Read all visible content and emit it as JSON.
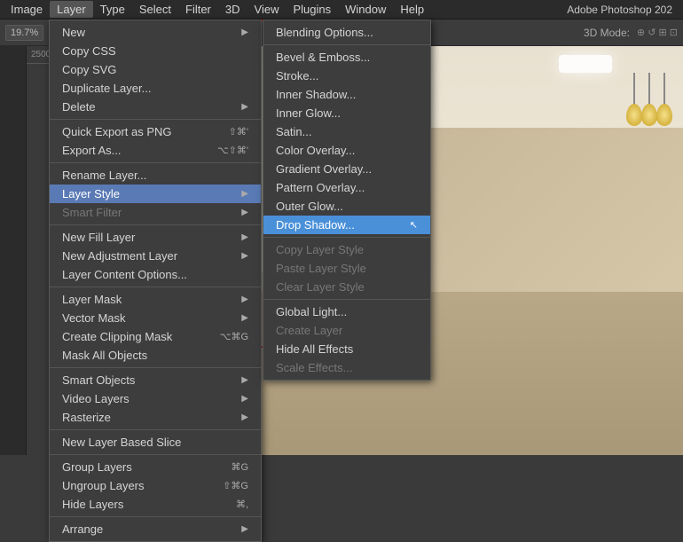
{
  "app": {
    "title": "Adobe Photoshop 202"
  },
  "menubar": {
    "items": [
      {
        "id": "image",
        "label": "Image"
      },
      {
        "id": "layer",
        "label": "Layer"
      },
      {
        "id": "type",
        "label": "Type"
      },
      {
        "id": "select",
        "label": "Select"
      },
      {
        "id": "filter",
        "label": "Filter"
      },
      {
        "id": "3d",
        "label": "3D"
      },
      {
        "id": "view",
        "label": "View"
      },
      {
        "id": "plugins",
        "label": "Plugins"
      },
      {
        "id": "window",
        "label": "Window"
      },
      {
        "id": "help",
        "label": "Help"
      }
    ]
  },
  "toolbar": {
    "zoom_label": "19.7%",
    "mode_label": "3D Mode:"
  },
  "layer_menu": {
    "items": [
      {
        "id": "new",
        "label": "New",
        "arrow": true,
        "shortcut": ""
      },
      {
        "id": "copy-css",
        "label": "Copy CSS",
        "arrow": false,
        "shortcut": ""
      },
      {
        "id": "copy-svg",
        "label": "Copy SVG",
        "arrow": false,
        "shortcut": ""
      },
      {
        "id": "duplicate-layer",
        "label": "Duplicate Layer...",
        "arrow": false,
        "shortcut": ""
      },
      {
        "id": "delete",
        "label": "Delete",
        "arrow": true,
        "shortcut": ""
      },
      {
        "id": "sep1",
        "type": "separator"
      },
      {
        "id": "quick-export",
        "label": "Quick Export as PNG",
        "arrow": false,
        "shortcut": "⇧⌘'"
      },
      {
        "id": "export-as",
        "label": "Export As...",
        "arrow": false,
        "shortcut": "⌥⇧⌘'"
      },
      {
        "id": "sep2",
        "type": "separator"
      },
      {
        "id": "rename-layer",
        "label": "Rename Layer...",
        "arrow": false,
        "shortcut": ""
      },
      {
        "id": "layer-style",
        "label": "Layer Style",
        "arrow": true,
        "shortcut": "",
        "highlighted": true
      },
      {
        "id": "smart-filter",
        "label": "Smart Filter",
        "arrow": false,
        "shortcut": "",
        "disabled": true
      },
      {
        "id": "sep3",
        "type": "separator"
      },
      {
        "id": "new-fill-layer",
        "label": "New Fill Layer",
        "arrow": true,
        "shortcut": ""
      },
      {
        "id": "new-adjustment-layer",
        "label": "New Adjustment Layer",
        "arrow": true,
        "shortcut": ""
      },
      {
        "id": "layer-content-options",
        "label": "Layer Content Options...",
        "arrow": false,
        "shortcut": ""
      },
      {
        "id": "sep4",
        "type": "separator"
      },
      {
        "id": "layer-mask",
        "label": "Layer Mask",
        "arrow": true,
        "shortcut": ""
      },
      {
        "id": "vector-mask",
        "label": "Vector Mask",
        "arrow": true,
        "shortcut": ""
      },
      {
        "id": "create-clipping-mask",
        "label": "Create Clipping Mask",
        "arrow": false,
        "shortcut": "⌥⌘G"
      },
      {
        "id": "mask-all-objects",
        "label": "Mask All Objects",
        "arrow": false,
        "shortcut": ""
      },
      {
        "id": "sep5",
        "type": "separator"
      },
      {
        "id": "smart-objects",
        "label": "Smart Objects",
        "arrow": true,
        "shortcut": ""
      },
      {
        "id": "video-layers",
        "label": "Video Layers",
        "arrow": true,
        "shortcut": ""
      },
      {
        "id": "rasterize",
        "label": "Rasterize",
        "arrow": true,
        "shortcut": ""
      },
      {
        "id": "sep6",
        "type": "separator"
      },
      {
        "id": "new-layer-based-slice",
        "label": "New Layer Based Slice",
        "arrow": false,
        "shortcut": ""
      },
      {
        "id": "sep7",
        "type": "separator"
      },
      {
        "id": "group-layers",
        "label": "Group Layers",
        "arrow": false,
        "shortcut": "⌘G"
      },
      {
        "id": "ungroup-layers",
        "label": "Ungroup Layers",
        "arrow": false,
        "shortcut": "⇧⌘G"
      },
      {
        "id": "hide-layers",
        "label": "Hide Layers",
        "arrow": false,
        "shortcut": "⌘,"
      },
      {
        "id": "sep8",
        "type": "separator"
      },
      {
        "id": "arrange",
        "label": "Arrange",
        "arrow": true,
        "shortcut": ""
      }
    ]
  },
  "layer_style_menu": {
    "items": [
      {
        "id": "blending-options",
        "label": "Blending Options...",
        "disabled": false
      },
      {
        "id": "sep1",
        "type": "separator"
      },
      {
        "id": "bevel-emboss",
        "label": "Bevel & Emboss...",
        "disabled": false
      },
      {
        "id": "stroke",
        "label": "Stroke...",
        "disabled": false
      },
      {
        "id": "inner-shadow",
        "label": "Inner Shadow...",
        "disabled": false
      },
      {
        "id": "inner-glow",
        "label": "Inner Glow...",
        "disabled": false
      },
      {
        "id": "satin",
        "label": "Satin...",
        "disabled": false
      },
      {
        "id": "color-overlay",
        "label": "Color Overlay...",
        "disabled": false
      },
      {
        "id": "gradient-overlay",
        "label": "Gradient Overlay...",
        "disabled": false
      },
      {
        "id": "pattern-overlay",
        "label": "Pattern Overlay...",
        "disabled": false
      },
      {
        "id": "outer-glow",
        "label": "Outer Glow...",
        "disabled": false
      },
      {
        "id": "drop-shadow",
        "label": "Drop Shadow...",
        "disabled": false,
        "active": true
      },
      {
        "id": "sep2",
        "type": "separator"
      },
      {
        "id": "copy-layer-style",
        "label": "Copy Layer Style",
        "disabled": true
      },
      {
        "id": "paste-layer-style",
        "label": "Paste Layer Style",
        "disabled": true
      },
      {
        "id": "clear-layer-style",
        "label": "Clear Layer Style",
        "disabled": true
      },
      {
        "id": "sep3",
        "type": "separator"
      },
      {
        "id": "global-light",
        "label": "Global Light...",
        "disabled": false
      },
      {
        "id": "create-layer",
        "label": "Create Layer",
        "disabled": true
      },
      {
        "id": "hide-all-effects",
        "label": "Hide All Effects",
        "disabled": false
      },
      {
        "id": "scale-effects",
        "label": "Scale Effects...",
        "disabled": true
      }
    ]
  }
}
